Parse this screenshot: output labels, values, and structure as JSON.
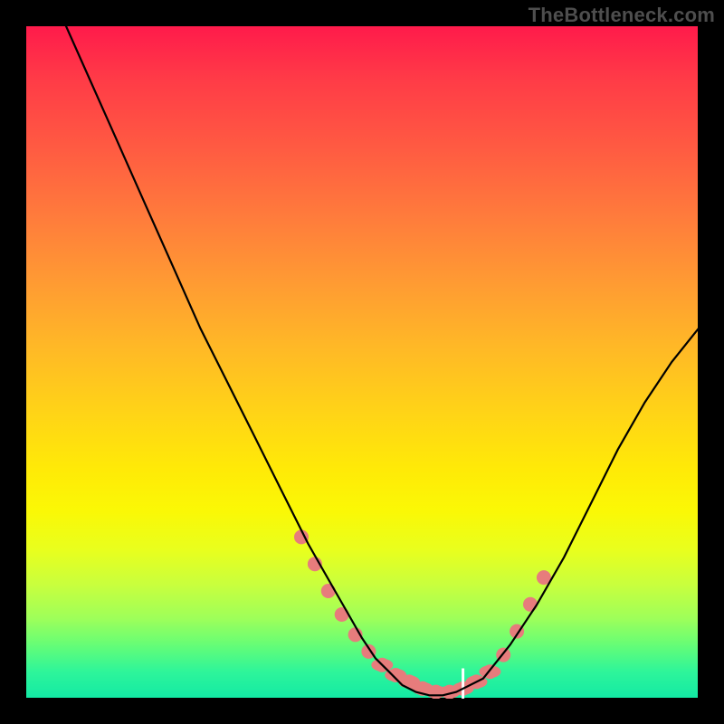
{
  "watermark": "TheBottleneck.com",
  "chart_data": {
    "type": "line",
    "title": "",
    "xlabel": "",
    "ylabel": "",
    "xlim": [
      0,
      100
    ],
    "ylim": [
      0,
      100
    ],
    "series": [
      {
        "name": "bottleneck-curve",
        "x": [
          6,
          10,
          14,
          18,
          22,
          26,
          30,
          34,
          38,
          42,
          46,
          50,
          52,
          54,
          56,
          58,
          60,
          62,
          64,
          68,
          72,
          76,
          80,
          84,
          88,
          92,
          96,
          100
        ],
        "y": [
          100,
          91,
          82,
          73,
          64,
          55,
          47,
          39,
          31,
          23,
          16,
          9,
          6,
          4,
          2,
          1,
          0.5,
          0.5,
          1,
          3,
          8,
          14,
          21,
          29,
          37,
          44,
          50,
          55
        ]
      }
    ],
    "markers": {
      "name": "highlight-dots",
      "x": [
        41,
        43,
        45,
        47,
        49,
        51,
        53,
        55,
        57,
        59,
        61,
        63,
        65,
        67,
        69,
        71,
        73,
        75,
        77
      ],
      "y": [
        24,
        20,
        16,
        12.5,
        9.5,
        7,
        5,
        3.5,
        2.5,
        1.5,
        1,
        1,
        1.5,
        2.5,
        4,
        6.5,
        10,
        14,
        18
      ]
    },
    "white_tick": {
      "x": 65,
      "y0": 0,
      "y1": 4.5
    },
    "gradient_note": "Background hue roughly encodes y-value: red ≈ 100 (high bottleneck) → green ≈ 0 (balanced)."
  }
}
